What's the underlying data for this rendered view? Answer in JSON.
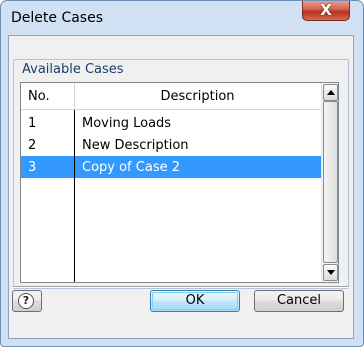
{
  "window": {
    "title": "Delete Cases",
    "close_glyph": "X"
  },
  "group": {
    "title": "Available Cases"
  },
  "table": {
    "headers": {
      "no": "No.",
      "description": "Description"
    },
    "rows": [
      {
        "no": "1",
        "description": "Moving Loads",
        "selected": false
      },
      {
        "no": "2",
        "description": "New Description",
        "selected": false
      },
      {
        "no": "3",
        "description": "Copy of Case 2",
        "selected": true
      }
    ]
  },
  "buttons": {
    "ok": "OK",
    "cancel": "Cancel",
    "help_icon": "help-icon"
  },
  "colors": {
    "selection": "#3399ff",
    "close_button": "#c7432d",
    "window_frame": "#cfe1f3"
  }
}
